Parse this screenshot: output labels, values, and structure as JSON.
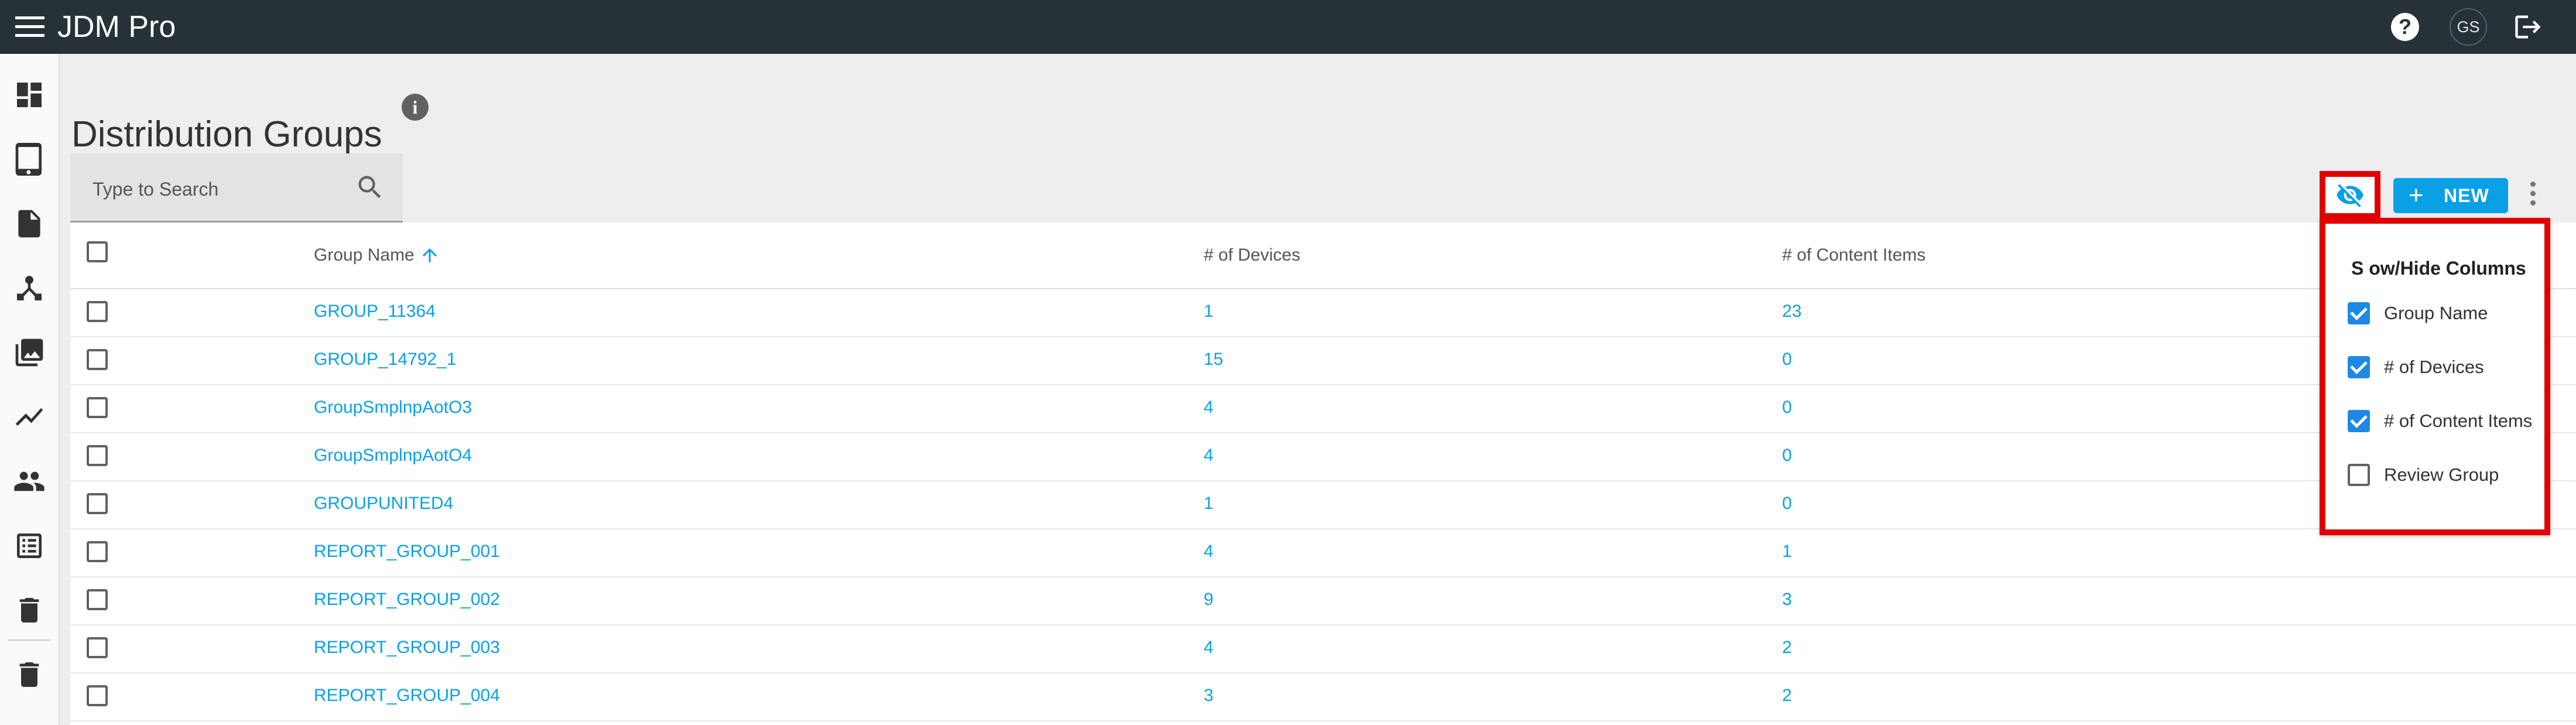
{
  "app": {
    "title": "JDM Pro",
    "user_initials": "GS"
  },
  "icons": {
    "menu": "menu-icon",
    "help": "help-icon",
    "logout": "logout-icon",
    "info": "info-icon",
    "search": "search-icon",
    "sort": "arrow-up-icon",
    "visibility": "visibility-off-icon",
    "more": "more-vert-icon"
  },
  "nav": [
    "dashboard",
    "devices",
    "documents",
    "hierarchy",
    "media",
    "analytics",
    "users",
    "list",
    "trash",
    "trash"
  ],
  "page": {
    "title": "Distribution Groups",
    "info_glyph": "i"
  },
  "search": {
    "placeholder": "Type to Search",
    "value": ""
  },
  "toolbar": {
    "new_label": "NEW",
    "plus_glyph": "+"
  },
  "table": {
    "columns": [
      "Group Name",
      "# of Devices",
      "# of Content Items"
    ],
    "rows": [
      {
        "name": "GROUP_11364",
        "devices": "1",
        "content": "23"
      },
      {
        "name": "GROUP_14792_1",
        "devices": "15",
        "content": "0"
      },
      {
        "name": "GroupSmplnpAotO3",
        "devices": "4",
        "content": "0"
      },
      {
        "name": "GroupSmplnpAotO4",
        "devices": "4",
        "content": "0"
      },
      {
        "name": "GROUPUNITED4",
        "devices": "1",
        "content": "0"
      },
      {
        "name": "REPORT_GROUP_001",
        "devices": "4",
        "content": "1"
      },
      {
        "name": "REPORT_GROUP_002",
        "devices": "9",
        "content": "3"
      },
      {
        "name": "REPORT_GROUP_003",
        "devices": "4",
        "content": "2"
      },
      {
        "name": "REPORT_GROUP_004",
        "devices": "3",
        "content": "2"
      }
    ]
  },
  "column_panel": {
    "title": "S ow/Hide Columns",
    "options": [
      {
        "label": "Group Name",
        "checked": true
      },
      {
        "label": "# of Devices",
        "checked": true
      },
      {
        "label": "# of Content Items",
        "checked": true
      },
      {
        "label": "Review Group",
        "checked": false
      }
    ]
  },
  "colors": {
    "topbar": "#263238",
    "accent": "#0aa0e6",
    "highlight": "#e00000"
  }
}
